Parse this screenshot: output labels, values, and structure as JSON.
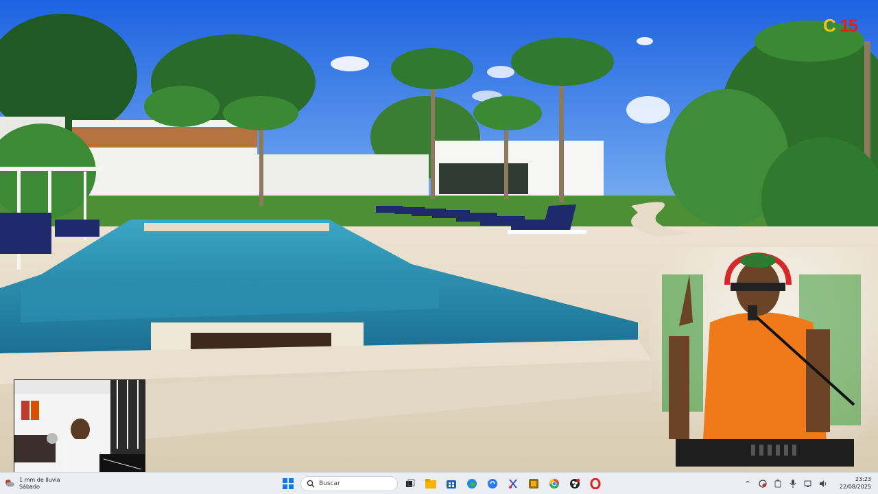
{
  "video": {
    "logo": {
      "text_left": "C",
      "text_right": "15"
    }
  },
  "taskbar": {
    "weather": {
      "line1": "1 mm de lluvia",
      "line2": "Sábado"
    },
    "search_placeholder": "Buscar",
    "apps": [
      {
        "name": "start-icon",
        "color": "#1a73e8"
      },
      {
        "name": "task-view-icon",
        "color": "#222222"
      },
      {
        "name": "file-explorer-icon",
        "color": "#f4b400"
      },
      {
        "name": "store-icon",
        "color": "#1a5fb4"
      },
      {
        "name": "edge-icon",
        "color": "#1e88e5"
      },
      {
        "name": "copilot-icon",
        "color": "#2979ff"
      },
      {
        "name": "snipping-tool-icon",
        "color": "#3f51b5"
      },
      {
        "name": "app-r-icon",
        "color": "#8d6e00"
      },
      {
        "name": "chrome-icon",
        "color": "#34a853"
      },
      {
        "name": "obs-icon",
        "color": "#222222"
      },
      {
        "name": "opera-icon",
        "color": "#e0201c"
      }
    ],
    "tray": {
      "chevron": "^",
      "icons": [
        "network-shield-icon",
        "battery-saver-icon",
        "microphone-icon",
        "wifi-icon",
        "volume-icon"
      ]
    },
    "clock": {
      "time": "23:23",
      "date": "22/08/2025"
    }
  }
}
